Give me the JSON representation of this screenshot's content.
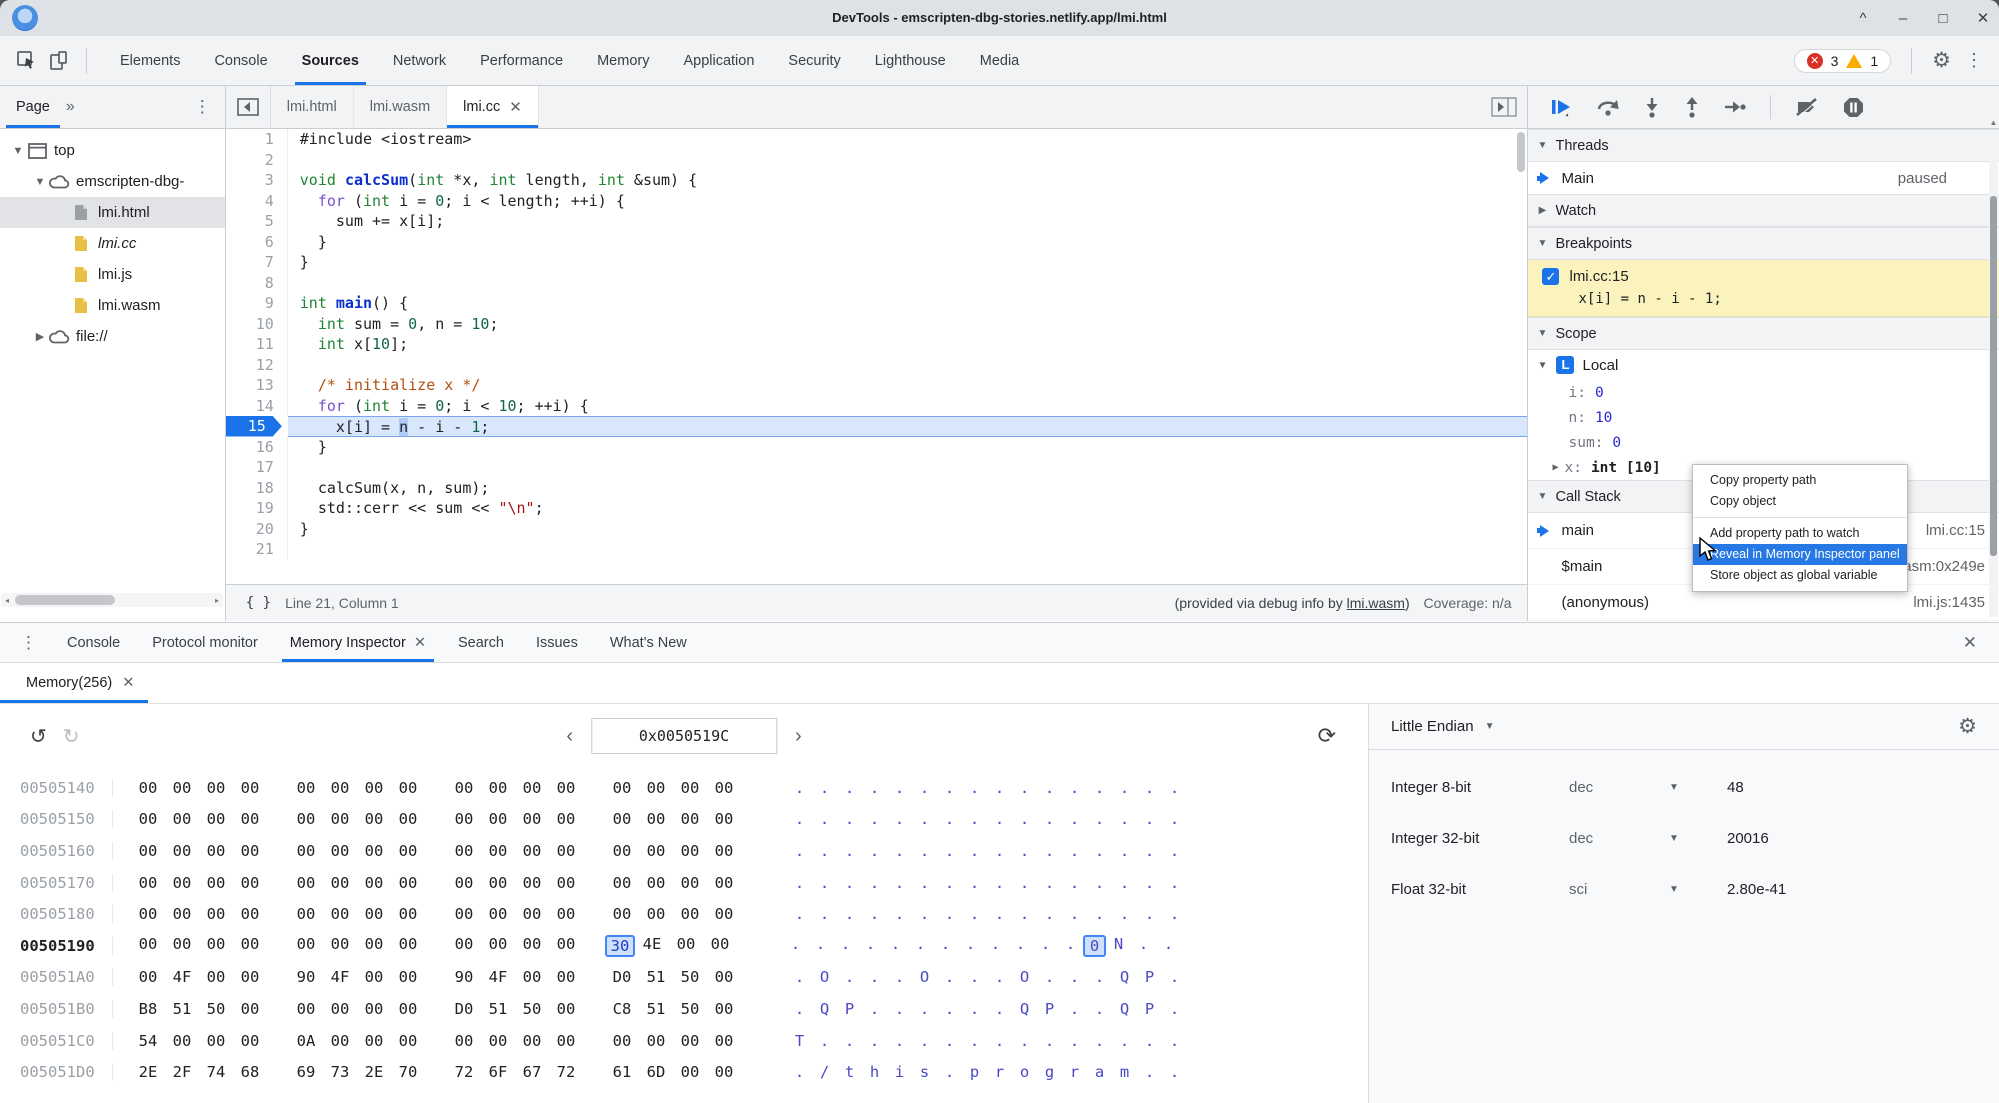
{
  "window": {
    "title": "DevTools - emscripten-dbg-stories.netlify.app/lmi.html",
    "controls": [
      "^",
      "–",
      "□",
      "✕"
    ]
  },
  "toolbar": {
    "tabs": [
      "Elements",
      "Console",
      "Sources",
      "Network",
      "Performance",
      "Memory",
      "Application",
      "Security",
      "Lighthouse",
      "Media"
    ],
    "active_tab": "Sources",
    "error_count": "3",
    "warning_count": "1"
  },
  "navigator": {
    "tab_label": "Page",
    "more_glyph": "»",
    "tree": [
      {
        "label": "top",
        "icon": "window",
        "depth": 0,
        "expander": "open"
      },
      {
        "label": "emscripten-dbg-",
        "icon": "cloud",
        "depth": 1,
        "expander": "open"
      },
      {
        "label": "lmi.html",
        "icon": "file-gray",
        "depth": 2,
        "selected": true
      },
      {
        "label": "lmi.cc",
        "icon": "file-yellow",
        "depth": 2,
        "italic": true
      },
      {
        "label": "lmi.js",
        "icon": "file-yellow",
        "depth": 2
      },
      {
        "label": "lmi.wasm",
        "icon": "file-yellow",
        "depth": 2
      },
      {
        "label": "file://",
        "icon": "cloud",
        "depth": 1,
        "expander": "closed"
      }
    ]
  },
  "editor": {
    "tabs": [
      {
        "label": "lmi.html"
      },
      {
        "label": "lmi.wasm"
      },
      {
        "label": "lmi.cc",
        "active": true,
        "closable": true
      }
    ],
    "lines": [
      {
        "n": 1,
        "toks": [
          [
            "p",
            "#include <iostream>"
          ]
        ]
      },
      {
        "n": 2,
        "toks": []
      },
      {
        "n": 3,
        "toks": [
          [
            "t",
            "void "
          ],
          [
            "f",
            "calcSum"
          ],
          [
            "p",
            "("
          ],
          [
            "t",
            "int"
          ],
          [
            "p",
            " *x, "
          ],
          [
            "t",
            "int"
          ],
          [
            "p",
            " length, "
          ],
          [
            "t",
            "int"
          ],
          [
            "p",
            " &sum) {"
          ]
        ]
      },
      {
        "n": 4,
        "toks": [
          [
            "p",
            "  "
          ],
          [
            "k",
            "for"
          ],
          [
            "p",
            " ("
          ],
          [
            "t",
            "int"
          ],
          [
            "p",
            " i = "
          ],
          [
            "n",
            "0"
          ],
          [
            "p",
            "; i < length; ++i) {"
          ]
        ]
      },
      {
        "n": 5,
        "toks": [
          [
            "p",
            "    sum += x[i];"
          ]
        ]
      },
      {
        "n": 6,
        "toks": [
          [
            "p",
            "  }"
          ]
        ]
      },
      {
        "n": 7,
        "toks": [
          [
            "p",
            "}"
          ]
        ]
      },
      {
        "n": 8,
        "toks": []
      },
      {
        "n": 9,
        "toks": [
          [
            "t",
            "int "
          ],
          [
            "f",
            "main"
          ],
          [
            "p",
            "() {"
          ]
        ]
      },
      {
        "n": 10,
        "toks": [
          [
            "p",
            "  "
          ],
          [
            "t",
            "int"
          ],
          [
            "p",
            " sum = "
          ],
          [
            "n",
            "0"
          ],
          [
            "p",
            ", n = "
          ],
          [
            "n",
            "10"
          ],
          [
            "p",
            ";"
          ]
        ]
      },
      {
        "n": 11,
        "toks": [
          [
            "p",
            "  "
          ],
          [
            "t",
            "int"
          ],
          [
            "p",
            " x["
          ],
          [
            "n",
            "10"
          ],
          [
            "p",
            "];"
          ]
        ]
      },
      {
        "n": 12,
        "toks": []
      },
      {
        "n": 13,
        "toks": [
          [
            "p",
            "  "
          ],
          [
            "c",
            "/* initialize x */"
          ]
        ]
      },
      {
        "n": 14,
        "toks": [
          [
            "p",
            "  "
          ],
          [
            "k",
            "for"
          ],
          [
            "p",
            " ("
          ],
          [
            "t",
            "int"
          ],
          [
            "p",
            " i = "
          ],
          [
            "n",
            "0"
          ],
          [
            "p",
            "; i < "
          ],
          [
            "n",
            "10"
          ],
          [
            "p",
            "; ++i) {"
          ]
        ]
      },
      {
        "n": 15,
        "toks": [
          [
            "p",
            "    x[i] = "
          ],
          [
            "sel",
            "n"
          ],
          [
            "p",
            " - i - "
          ],
          [
            "n",
            "1"
          ],
          [
            "p",
            ";"
          ]
        ],
        "exec": true
      },
      {
        "n": 16,
        "toks": [
          [
            "p",
            "  }"
          ]
        ]
      },
      {
        "n": 17,
        "toks": []
      },
      {
        "n": 18,
        "toks": [
          [
            "p",
            "  calcSum(x, n, sum);"
          ]
        ]
      },
      {
        "n": 19,
        "toks": [
          [
            "p",
            "  std::cerr << sum << "
          ],
          [
            "s",
            "\"\\n\""
          ],
          [
            "p",
            ";"
          ]
        ]
      },
      {
        "n": 20,
        "toks": [
          [
            "p",
            "}"
          ]
        ]
      },
      {
        "n": 21,
        "toks": []
      }
    ],
    "status": {
      "position": "Line 21, Column 1",
      "provided_prefix": "(provided via debug info by ",
      "provided_link": "lmi.wasm",
      "provided_suffix": ")",
      "coverage": "Coverage: n/a"
    }
  },
  "debug": {
    "threads": {
      "title": "Threads",
      "main_label": "Main",
      "state": "paused"
    },
    "watch": {
      "title": "Watch"
    },
    "breakpoints": {
      "title": "Breakpoints",
      "entry": {
        "file": "lmi.cc:15",
        "code": "x[i] = n - i - 1;",
        "checked": true
      }
    },
    "scope": {
      "title": "Scope",
      "local_label": "Local",
      "vars": [
        {
          "name": "i",
          "value": "0"
        },
        {
          "name": "n",
          "value": "10"
        },
        {
          "name": "sum",
          "value": "0"
        },
        {
          "name": "x",
          "value": "int [10]",
          "expandable": true,
          "object": true
        }
      ]
    },
    "call_stack": {
      "title": "Call Stack",
      "frames": [
        {
          "name": "main",
          "location": "lmi.cc:15",
          "active": true
        },
        {
          "name": "$main",
          "location": "lmi.wasm:0x249e"
        },
        {
          "name": "(anonymous)",
          "location": "lmi.js:1435"
        }
      ]
    }
  },
  "context_menu": {
    "items": [
      {
        "label": "Copy property path"
      },
      {
        "label": "Copy object"
      },
      {
        "separator": true
      },
      {
        "label": "Add property path to watch"
      },
      {
        "label": "Reveal in Memory Inspector panel",
        "highlighted": true
      },
      {
        "label": "Store object as global variable"
      }
    ]
  },
  "drawer": {
    "tabs": [
      {
        "label": "Console"
      },
      {
        "label": "Protocol monitor"
      },
      {
        "label": "Memory Inspector",
        "active": true,
        "closable": true
      },
      {
        "label": "Search"
      },
      {
        "label": "Issues"
      },
      {
        "label": "What's New"
      }
    ],
    "memory_tab": {
      "label": "Memory(256)"
    },
    "inspector": {
      "address": "0x0050519C",
      "hex_rows": [
        {
          "addr": "00505140",
          "bytes": "00 00 00 00 00 00 00 00 00 00 00 00 00 00 00 00",
          "ascii": "................"
        },
        {
          "addr": "00505150",
          "bytes": "00 00 00 00 00 00 00 00 00 00 00 00 00 00 00 00",
          "ascii": "................"
        },
        {
          "addr": "00505160",
          "bytes": "00 00 00 00 00 00 00 00 00 00 00 00 00 00 00 00",
          "ascii": "................"
        },
        {
          "addr": "00505170",
          "bytes": "00 00 00 00 00 00 00 00 00 00 00 00 00 00 00 00",
          "ascii": "................"
        },
        {
          "addr": "00505180",
          "bytes": "00 00 00 00 00 00 00 00 00 00 00 00 00 00 00 00",
          "ascii": "................"
        },
        {
          "addr": "00505190",
          "bytes": "00 00 00 00 00 00 00 00 00 00 00 00 30 4E 00 00",
          "ascii": "............0N..",
          "bold": true,
          "hl": 12
        },
        {
          "addr": "005051A0",
          "bytes": "00 4F 00 00 90 4F 00 00 90 4F 00 00 D0 51 50 00",
          "ascii": ".O...O...O...QP."
        },
        {
          "addr": "005051B0",
          "bytes": "B8 51 50 00 00 00 00 00 D0 51 50 00 C8 51 50 00",
          "ascii": ".QP......QP..QP."
        },
        {
          "addr": "005051C0",
          "bytes": "54 00 00 00 0A 00 00 00 00 00 00 00 00 00 00 00",
          "ascii": "T..............."
        },
        {
          "addr": "005051D0",
          "bytes": "2E 2F 74 68 69 73 2E 70 72 6F 67 72 61 6D 00 00",
          "ascii": "./this.program.."
        }
      ],
      "value_panel": {
        "endianness": "Little Endian",
        "rows": [
          {
            "label": "Integer 8-bit",
            "format": "dec",
            "value": "48"
          },
          {
            "label": "Integer 32-bit",
            "format": "dec",
            "value": "20016"
          },
          {
            "label": "Float 32-bit",
            "format": "sci",
            "value": "2.80e-41"
          }
        ]
      }
    }
  },
  "colors": {
    "accent": "#1a73e8",
    "breakpoint_bg": "#faf3bd",
    "error": "#d93025",
    "warning": "#f9ab00"
  }
}
